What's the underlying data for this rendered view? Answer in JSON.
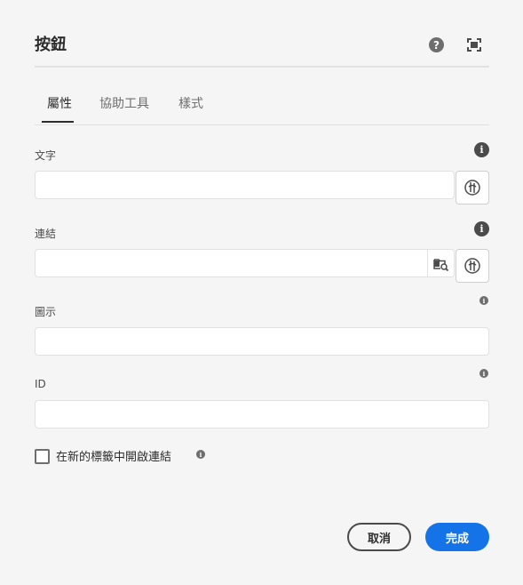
{
  "dialog": {
    "title": "按鈕"
  },
  "tabs": [
    {
      "label": "屬性",
      "active": true
    },
    {
      "label": "協助工具",
      "active": false
    },
    {
      "label": "樣式",
      "active": false
    }
  ],
  "fields": {
    "text": {
      "label": "文字",
      "value": "",
      "placeholder": ""
    },
    "link": {
      "label": "連結",
      "value": "",
      "placeholder": ""
    },
    "icon": {
      "label": "圖示",
      "value": "",
      "placeholder": ""
    },
    "id": {
      "label": "ID",
      "value": "",
      "placeholder": ""
    }
  },
  "checkbox": {
    "label": "在新的標籤中開啟連結",
    "checked": false
  },
  "buttons": {
    "cancel": "取消",
    "done": "完成"
  },
  "icons": {
    "help": "?",
    "info": "i"
  },
  "colors": {
    "primary": "#1473e6",
    "background": "#f5f5f5",
    "text": "#2c2c2c"
  }
}
